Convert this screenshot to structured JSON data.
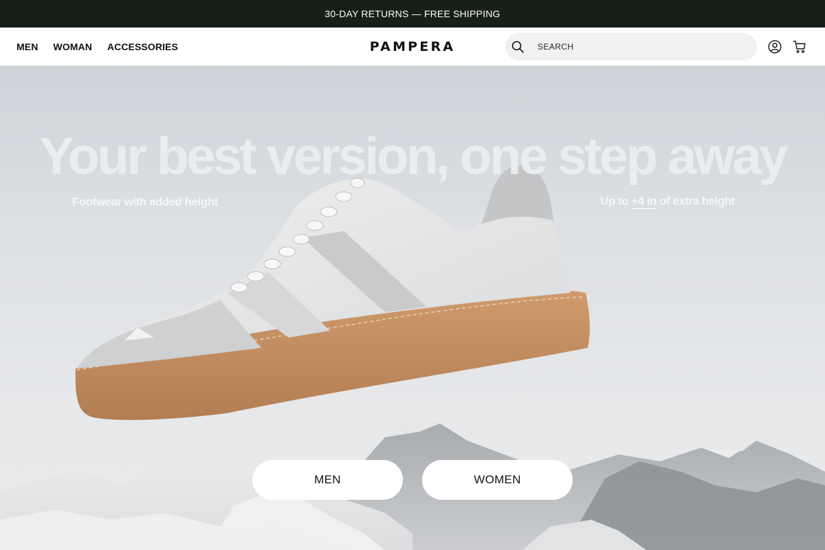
{
  "announcement": "30-DAY RETURNS — FREE SHIPPING",
  "nav": {
    "men": "MEN",
    "woman": "WOMAN",
    "accessories": "ACCESSORIES"
  },
  "logo": "PAMPERA",
  "search": {
    "placeholder": "SEARCH"
  },
  "icons": {
    "search": "search-icon",
    "account": "account-icon",
    "cart": "cart-icon"
  },
  "hero": {
    "headline": "Your best version, one step away",
    "subtitle_left": "Footwear with added height",
    "subtitle_right_prefix": "Up to ",
    "subtitle_right_highlight": "+4 in",
    "subtitle_right_suffix": " of extra height",
    "cta_men": "MEN",
    "cta_women": "WOMEN"
  },
  "colors": {
    "announcement_bg": "#162019",
    "sole": "#c89466",
    "button_bg": "#ffffff"
  }
}
